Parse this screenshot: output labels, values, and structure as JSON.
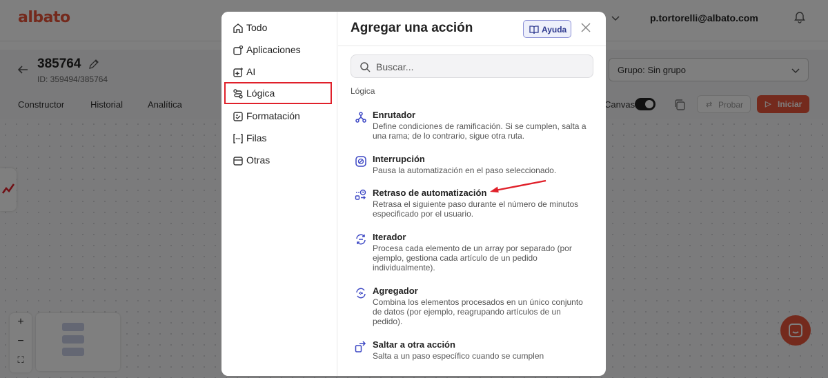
{
  "app": {
    "logo": "albato",
    "user_email": "p.tortorelli@albato.com"
  },
  "automation": {
    "title": "385764",
    "id_label": "ID: 359494/385764",
    "tabs": [
      "Constructor",
      "Historial",
      "Analítica"
    ],
    "group_select": "Grupo: Sin grupo",
    "canvas_label": "Canvas",
    "canvas_toggle_on": true,
    "probar_label": "Probar",
    "iniciar_label": "Iniciar"
  },
  "colors": {
    "brand": "#e8553a",
    "highlight": "#e0202a",
    "help_accent": "#2f3a8f",
    "icon_accent": "#3b46c4"
  },
  "modal": {
    "title": "Agregar una acción",
    "help_label": "Ayuda",
    "search_placeholder": "Buscar...",
    "section_label": "Lógica",
    "categories": [
      {
        "label": "Todo",
        "icon": "home-icon"
      },
      {
        "label": "Aplicaciones",
        "icon": "apps-icon"
      },
      {
        "label": "AI",
        "icon": "ai-sparkle-icon"
      },
      {
        "label": "Lógica",
        "icon": "logic-flow-icon",
        "selected": true
      },
      {
        "label": "Formatación",
        "icon": "format-icon"
      },
      {
        "label": "Filas",
        "icon": "rows-brackets-icon"
      },
      {
        "label": "Otras",
        "icon": "box-icon"
      }
    ],
    "actions": [
      {
        "name": "Enrutador",
        "description": "Define condiciones de ramificación. Si se cumplen, salta a una rama; de lo contrario, sigue otra ruta.",
        "icon": "router-icon"
      },
      {
        "name": "Interrupción",
        "description": "Pausa la automatización en el paso seleccionado.",
        "icon": "stop-icon"
      },
      {
        "name": "Retraso de automatización",
        "description": "Retrasa el siguiente paso durante el número de minutos especificado por el usuario.",
        "icon": "delay-icon"
      },
      {
        "name": "Iterador",
        "description": "Procesa cada elemento de un array por separado (por ejemplo, gestiona cada artículo de un pedido individualmente).",
        "icon": "iterator-icon"
      },
      {
        "name": "Agregador",
        "description": "Combina los elementos procesados en un único conjunto de datos (por ejemplo, reagrupando artículos de un pedido).",
        "icon": "aggregator-icon"
      },
      {
        "name": "Saltar a otra acción",
        "description": "Salta a un paso específico cuando se cumplen",
        "icon": "jump-icon"
      }
    ]
  }
}
